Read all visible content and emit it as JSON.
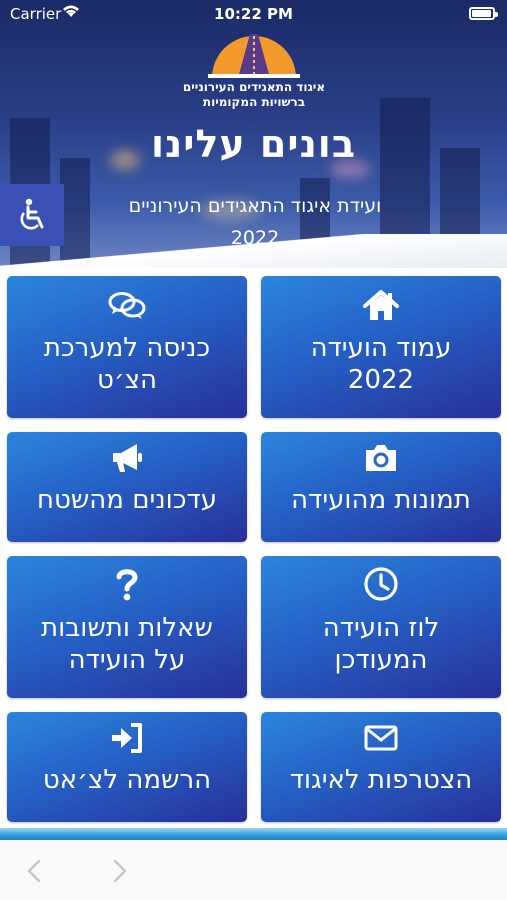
{
  "status_bar": {
    "carrier": "Carrier",
    "time": "10:22 PM",
    "battery_level": 0.95
  },
  "header": {
    "org_name_line1": "איגוד התאגידים העירוניים",
    "org_name_line2": "ברשויות המקומיות",
    "headline": "בונים עלינו",
    "subtitle_line1": "ועידת איגוד התאגידים העירוניים",
    "subtitle_line2": "2022"
  },
  "tiles": [
    {
      "icon": "home-icon",
      "line1": "עמוד הועידה",
      "line2": "2022"
    },
    {
      "icon": "chat-icon",
      "line1": "כניסה למערכת",
      "line2": "הצ׳ט"
    },
    {
      "icon": "camera-icon",
      "line1": "תמונות מהועידה",
      "line2": ""
    },
    {
      "icon": "megaphone-icon",
      "line1": "עדכונים מהשטח",
      "line2": ""
    },
    {
      "icon": "clock-icon",
      "line1": "לוז הועידה",
      "line2": "המעודכן"
    },
    {
      "icon": "question-icon",
      "line1": "שאלות ותשובות",
      "line2": "על הועידה"
    },
    {
      "icon": "envelope-icon",
      "line1": "הצטרפות לאיגוד",
      "line2": ""
    },
    {
      "icon": "sign-in-icon",
      "line1": "הרשמה לצ׳אט",
      "line2": ""
    }
  ],
  "colors": {
    "tile_start": "#2b86dd",
    "tile_end": "#27309a",
    "accessibility_bg": "#3a50b5",
    "logo_orange": "#f29a2e"
  }
}
